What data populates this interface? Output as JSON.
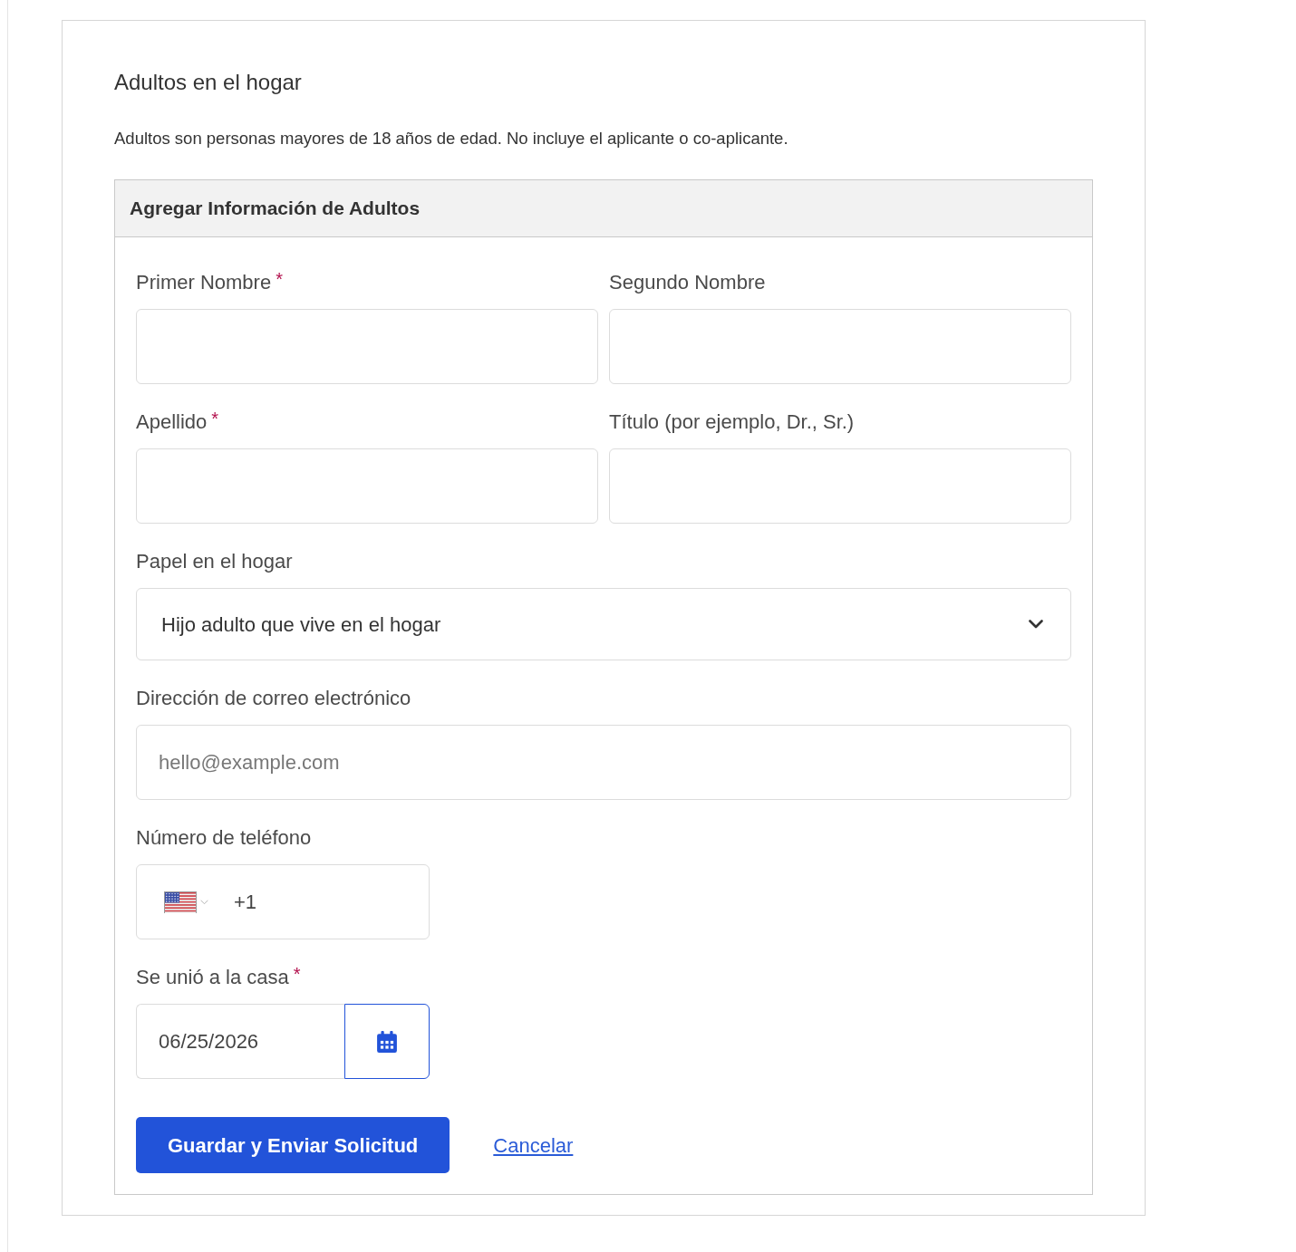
{
  "section": {
    "title": "Adultos en el hogar",
    "description": "Adultos son personas mayores de 18 años de edad. No incluye el aplicante o co-aplicante."
  },
  "panel": {
    "title": "Agregar Información de Adultos",
    "rows": [
      {
        "fields": [
          {
            "kind": "text",
            "label": "Primer Nombre",
            "required_mark": "*"
          },
          {
            "kind": "text",
            "label": "Segundo Nombre"
          }
        ]
      },
      {
        "fields": [
          {
            "kind": "text",
            "label": "Apellido",
            "required_mark": "*"
          },
          {
            "kind": "text",
            "label": "Título (por ejemplo, Dr., Sr.)"
          }
        ]
      },
      {
        "fields": [
          {
            "kind": "select",
            "label": "Papel en el hogar",
            "value": "Hijo adulto que vive en el hogar"
          }
        ]
      },
      {
        "fields": [
          {
            "kind": "email",
            "label": "Dirección de correo electrónico",
            "placeholder": "hello@example.com"
          }
        ]
      },
      {
        "fields": [
          {
            "kind": "phone",
            "label": "Número de teléfono",
            "value": "+1"
          }
        ]
      },
      {
        "fields": [
          {
            "kind": "date",
            "label": "Se unió a la casa",
            "required_mark": "*",
            "value": "06/25/2026"
          }
        ]
      }
    ],
    "actions": [
      {
        "kind": "primary",
        "label": "Guardar y Enviar Solicitud"
      },
      {
        "kind": "link",
        "label": "Cancelar"
      }
    ]
  }
}
